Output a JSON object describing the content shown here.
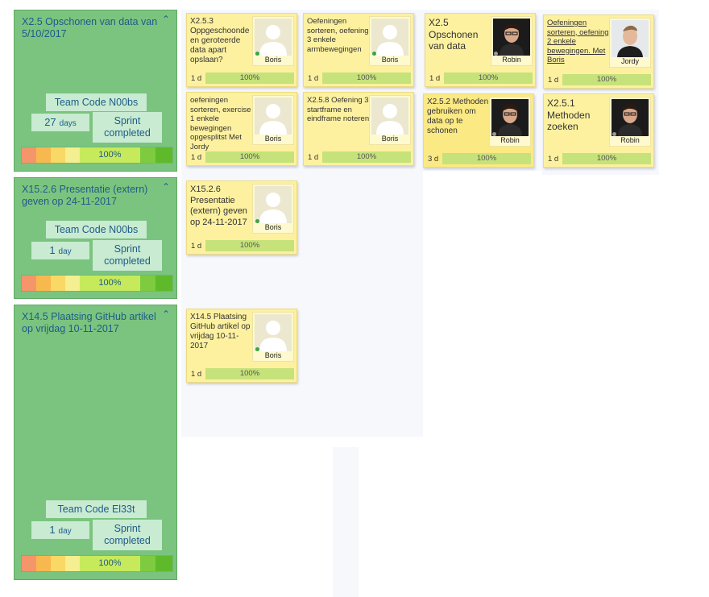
{
  "stories": [
    {
      "title": "X2.5 Opschonen van data van 5/10/2017",
      "team_code": "Team Code N00bs",
      "days": "27",
      "days_unit": "days",
      "sprint_status": "Sprint completed",
      "progress_label": "100%",
      "progress": 1.0
    },
    {
      "title": "X15.2.6 Presentatie (extern) geven op 24-11-2017",
      "team_code": "Team Code N00bs",
      "days": "1",
      "days_unit": "day",
      "sprint_status": "Sprint completed",
      "progress_label": "100%",
      "progress": 1.0
    },
    {
      "title": "X14.5 Plaatsing GitHub artikel op vrijdag 10-11-2017",
      "team_code": "Team Code El33t",
      "days": "1",
      "days_unit": "day",
      "sprint_status": "Sprint completed",
      "progress_label": "100%",
      "progress": 1.0
    }
  ],
  "progress_colors": [
    "#f4956a",
    "#f7b94f",
    "#f9d865",
    "#f4ef90",
    "#c6ea5b",
    "#7ecb3f",
    "#5fba2b"
  ],
  "cards": [
    {
      "title": "X2.5.3 Oppgeschoonde en geroteerde data apart opslaan?",
      "assignee": "Boris",
      "avatar": "placeholder",
      "estimate": "1 d",
      "progress": "100%"
    },
    {
      "title": "Oefeningen sorteren, oefening 3 enkele armbewegingen",
      "assignee": "Boris",
      "avatar": "placeholder",
      "estimate": "1 d",
      "progress": "100%"
    },
    {
      "title": "X2.5 Opschonen van data",
      "assignee": "Robin",
      "avatar": "robin",
      "estimate": "1 d",
      "progress": "100%"
    },
    {
      "title": "Oefeningen sorteren, oefening 2 enkele bewegingen. Met Boris",
      "assignee": "Jordy",
      "avatar": "jordy",
      "estimate": "1 d",
      "progress": "100%"
    },
    {
      "title": "oefeningen sorteren, exercise 1 enkele bewegingen opgesplitst Met Jordy",
      "assignee": "Boris",
      "avatar": "placeholder",
      "estimate": "1 d",
      "progress": "100%"
    },
    {
      "title": "X2.5.8 Oefening 3 startframe en eindframe noteren",
      "assignee": "Boris",
      "avatar": "placeholder",
      "estimate": "1 d",
      "progress": "100%"
    },
    {
      "title": "X2.5.2 Methoden gebruiken om data op te schonen",
      "assignee": "Robin",
      "avatar": "robin",
      "estimate": "3 d",
      "progress": "100%"
    },
    {
      "title": "X2.5.1 Methoden zoeken",
      "assignee": "Robin",
      "avatar": "robin",
      "estimate": "1 d",
      "progress": "100%"
    },
    {
      "title": "X15.2.6 Presentatie (extern) geven op 24-11-2017",
      "assignee": "Boris",
      "avatar": "placeholder",
      "estimate": "1 d",
      "progress": "100%"
    },
    {
      "title": "X14.5 Plaatsing GitHub artikel op vrijdag 10-11-2017",
      "assignee": "Boris",
      "avatar": "placeholder",
      "estimate": "1 d",
      "progress": "100%"
    }
  ]
}
